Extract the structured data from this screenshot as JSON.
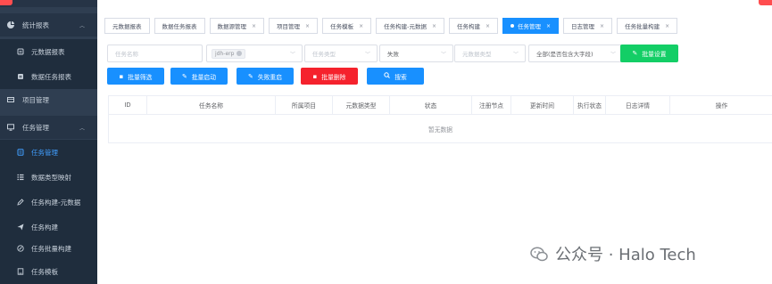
{
  "sidebar": {
    "groups": [
      {
        "label": "统计报表",
        "icon": "chart-pie-icon"
      },
      {
        "label": "项目管理",
        "icon": "project-icon"
      },
      {
        "label": "任务管理",
        "icon": "monitor-icon"
      }
    ],
    "stat_items": [
      {
        "label": "元数据报表",
        "icon": "report-icon"
      },
      {
        "label": "数据任务报表",
        "icon": "report-icon"
      }
    ],
    "task_items": [
      {
        "label": "任务管理",
        "icon": "task-icon",
        "active": true
      },
      {
        "label": "数据类型映射",
        "icon": "list-icon"
      },
      {
        "label": "任务构建-元数据",
        "icon": "edit-icon"
      },
      {
        "label": "任务构建",
        "icon": "send-icon"
      },
      {
        "label": "任务批量构建",
        "icon": "batch-icon"
      },
      {
        "label": "任务模板",
        "icon": "template-icon"
      }
    ]
  },
  "tabs": [
    {
      "label": "元数据报表",
      "closable": false
    },
    {
      "label": "数据任务报表",
      "closable": false
    },
    {
      "label": "数据源管理",
      "closable": true
    },
    {
      "label": "项目管理",
      "closable": true
    },
    {
      "label": "任务模板",
      "closable": true
    },
    {
      "label": "任务构建-元数据",
      "closable": true
    },
    {
      "label": "任务构建",
      "closable": true
    },
    {
      "label": "任务管理",
      "closable": true,
      "active": true
    },
    {
      "label": "日志管理",
      "closable": true
    },
    {
      "label": "任务批量构建",
      "closable": true
    }
  ],
  "filters": {
    "task_name_placeholder": "任务名称",
    "project_tag": "jdh-erp",
    "task_type_placeholder": "任务类型",
    "status_value": "失败",
    "metadata_type_placeholder": "元数据类型",
    "scope_value": "全部(是否包含大字段)"
  },
  "buttons": {
    "batch_config": "批量设置",
    "batch_filter": "批量筛选",
    "batch_start": "批量启动",
    "fail_restart": "失败重启",
    "batch_delete": "批量删除",
    "search": "搜索"
  },
  "table": {
    "columns": [
      "ID",
      "任务名称",
      "所属项目",
      "元数据类型",
      "状态",
      "注册节点",
      "更新时间",
      "执行状态",
      "日志详情",
      "操作"
    ],
    "empty_text": "暂无数据"
  },
  "watermark": {
    "text": "公众号 · Halo Tech"
  },
  "colors": {
    "sidebar_bg": "#2f3e51",
    "accent": "#1890ff",
    "danger": "#f5222d",
    "success": "#13ce66"
  }
}
